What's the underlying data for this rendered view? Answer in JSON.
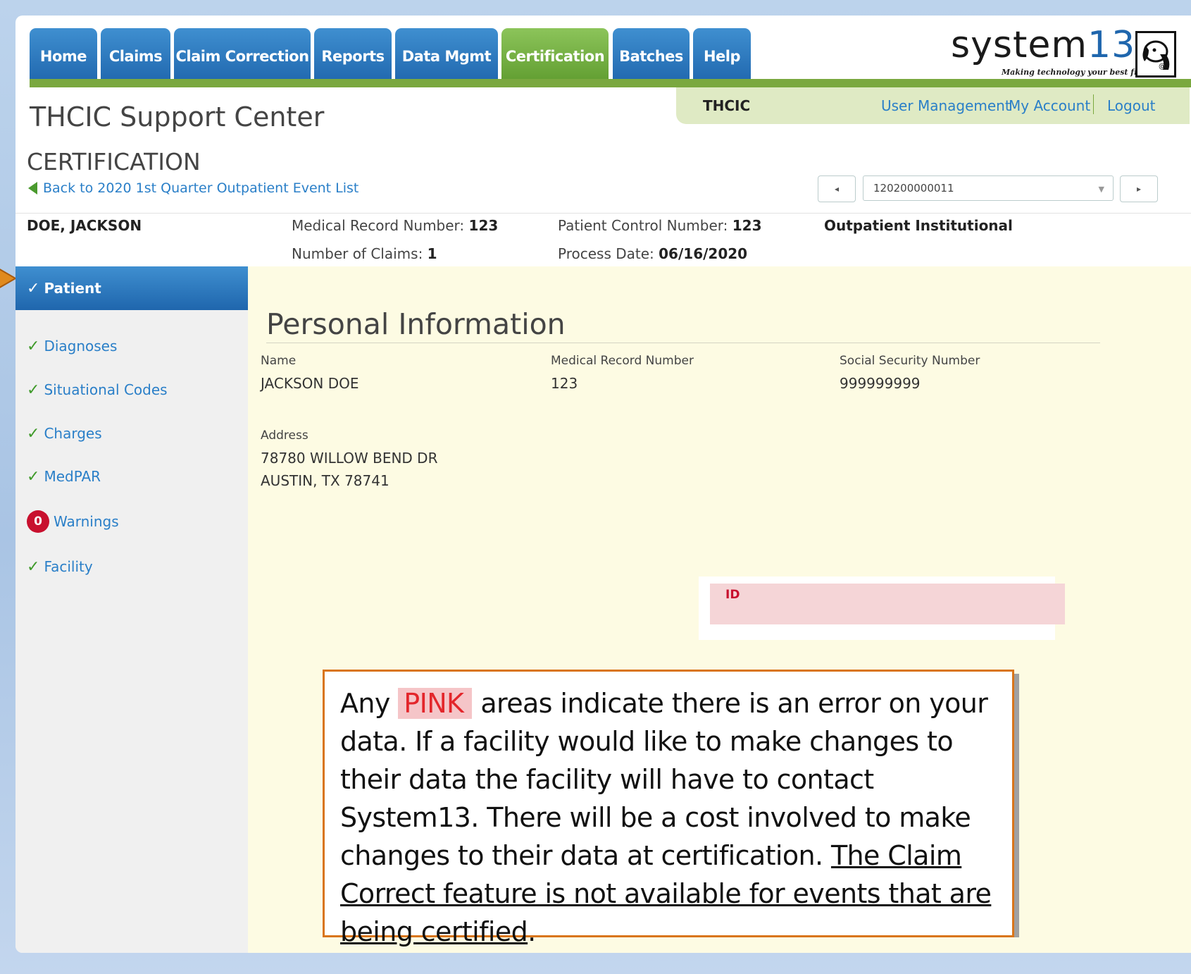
{
  "nav": {
    "tabs": [
      "Home",
      "Claims",
      "Claim Correction",
      "Reports",
      "Data Mgmt",
      "Certification",
      "Batches",
      "Help"
    ],
    "active": "Certification"
  },
  "logo": {
    "text_prefix": "system",
    "text_suffix": "13",
    "tagline": "Making technology your best friend."
  },
  "userbar": {
    "org": "THCIC",
    "user_management": "User Management",
    "my_account": "My Account",
    "logout": "Logout"
  },
  "app_title": "THCIC Support Center",
  "page_title": "CERTIFICATION",
  "back_link": "Back to 2020 1st Quarter Outpatient Event List",
  "claim_selector": {
    "value": "120200000011",
    "prev": "◂",
    "next": "▸"
  },
  "patient_header": {
    "name": "DOE, JACKSON",
    "mrn_label": "Medical Record Number:",
    "mrn": "123",
    "claims_label": "Number of Claims:",
    "claims": "1",
    "pcn_label": "Patient Control Number:",
    "pcn": "123",
    "process_label": "Process Date:",
    "process_date": "06/16/2020",
    "claim_type": "Outpatient Institutional"
  },
  "sidebar": {
    "items": [
      {
        "label": "Patient",
        "status": "check",
        "active": true
      },
      {
        "label": "Diagnoses",
        "status": "check"
      },
      {
        "label": "Situational Codes",
        "status": "check"
      },
      {
        "label": "Charges",
        "status": "check"
      },
      {
        "label": "MedPAR",
        "status": "check"
      },
      {
        "label": "Warnings",
        "status": "badge",
        "count": "0"
      },
      {
        "label": "Facility",
        "status": "check"
      }
    ]
  },
  "personal_info": {
    "title": "Personal Information",
    "name_label": "Name",
    "name": "JACKSON DOE",
    "mrn_label": "Medical Record Number",
    "mrn": "123",
    "ssn_label": "Social Security Number",
    "ssn": "999999999",
    "address_label": "Address",
    "address_line1": "78780 WILLOW BEND DR",
    "address_line2": "AUSTIN, TX 78741"
  },
  "id_error_label": "ID",
  "note": {
    "part1": "Any",
    "pink_word": "PINK",
    "part2": "areas indicate there is an error on your data.  If a facility would like to make changes to their data the facility will have to contact System13. There will be a cost involved to make changes to their data at certification.",
    "underlined": "The Claim Correct feature is not available for events that are being certified",
    "end": "."
  },
  "colors": {
    "tab_blue": "#1f66ad",
    "tab_green": "#5f9c2f",
    "link": "#2a7fc8",
    "error_pink": "#f5d5d7",
    "error_red": "#c8102e",
    "content_bg": "#fdfbe3",
    "callout_border": "#d9751a"
  }
}
